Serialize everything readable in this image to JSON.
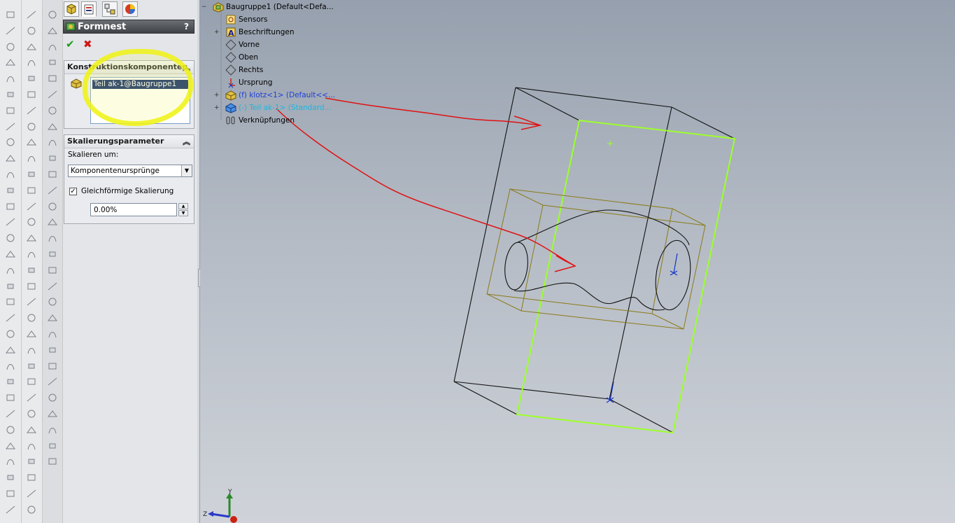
{
  "ribbon_icons": [
    "rebuild-icon",
    "sketch-icon",
    "extrude-icon",
    "line-icon",
    "rectangle-icon",
    "circle-icon",
    "arc-icon",
    "spline-icon",
    "point-icon",
    "dimension-icon",
    "fillet-icon",
    "chamfer-icon",
    "mirror-icon",
    "pattern-icon",
    "assembly-icon"
  ],
  "property_manager": {
    "tabs": [
      "feature-manager-tab",
      "property-manager-tab",
      "configuration-manager-tab",
      "display-manager-tab"
    ],
    "title": "Formnest",
    "help": "?",
    "ok_symbol": "✔",
    "cancel_symbol": "✖",
    "groups": {
      "components": {
        "title": "Konstruktionskomponenten",
        "items": [
          "Teil ak-1@Baugruppe1"
        ]
      },
      "scaling": {
        "title": "Skalierungsparameter",
        "scale_about_label": "Skalieren um:",
        "scale_about_value": "Komponentenursprünge",
        "uniform_checked": true,
        "uniform_label": "Gleichförmige Skalierung",
        "scale_value": "0.00%"
      }
    }
  },
  "feature_tree": {
    "root": "Baugruppe1  (Default<Defa...",
    "items": [
      {
        "label": "Sensors",
        "icon": "sensor-icon",
        "color": "#000000"
      },
      {
        "label": "Beschriftungen",
        "icon": "annotation-icon",
        "color": "#000000"
      },
      {
        "label": "Vorne",
        "icon": "plane-icon",
        "color": "#000000"
      },
      {
        "label": "Oben",
        "icon": "plane-icon",
        "color": "#000000"
      },
      {
        "label": "Rechts",
        "icon": "plane-icon",
        "color": "#000000"
      },
      {
        "label": "Ursprung",
        "icon": "origin-icon",
        "color": "#000000"
      },
      {
        "label": "(f) klotz<1> (Default<<...",
        "icon": "part-icon",
        "color": "#1f3fd8"
      },
      {
        "label": "(-) Teil ak-1> (Standard...",
        "icon": "part-blue-icon",
        "color": "#19b7e0"
      },
      {
        "label": "Verknüpfungen",
        "icon": "mates-icon",
        "color": "#000000"
      }
    ]
  },
  "triad": {
    "y": "Y",
    "z": "Z"
  },
  "colors": {
    "selection_green": "#9dff2a",
    "annotation_red": "#e01212",
    "cavity_olive": "#8a7a18",
    "highlight_yellow": "#f0f214"
  }
}
